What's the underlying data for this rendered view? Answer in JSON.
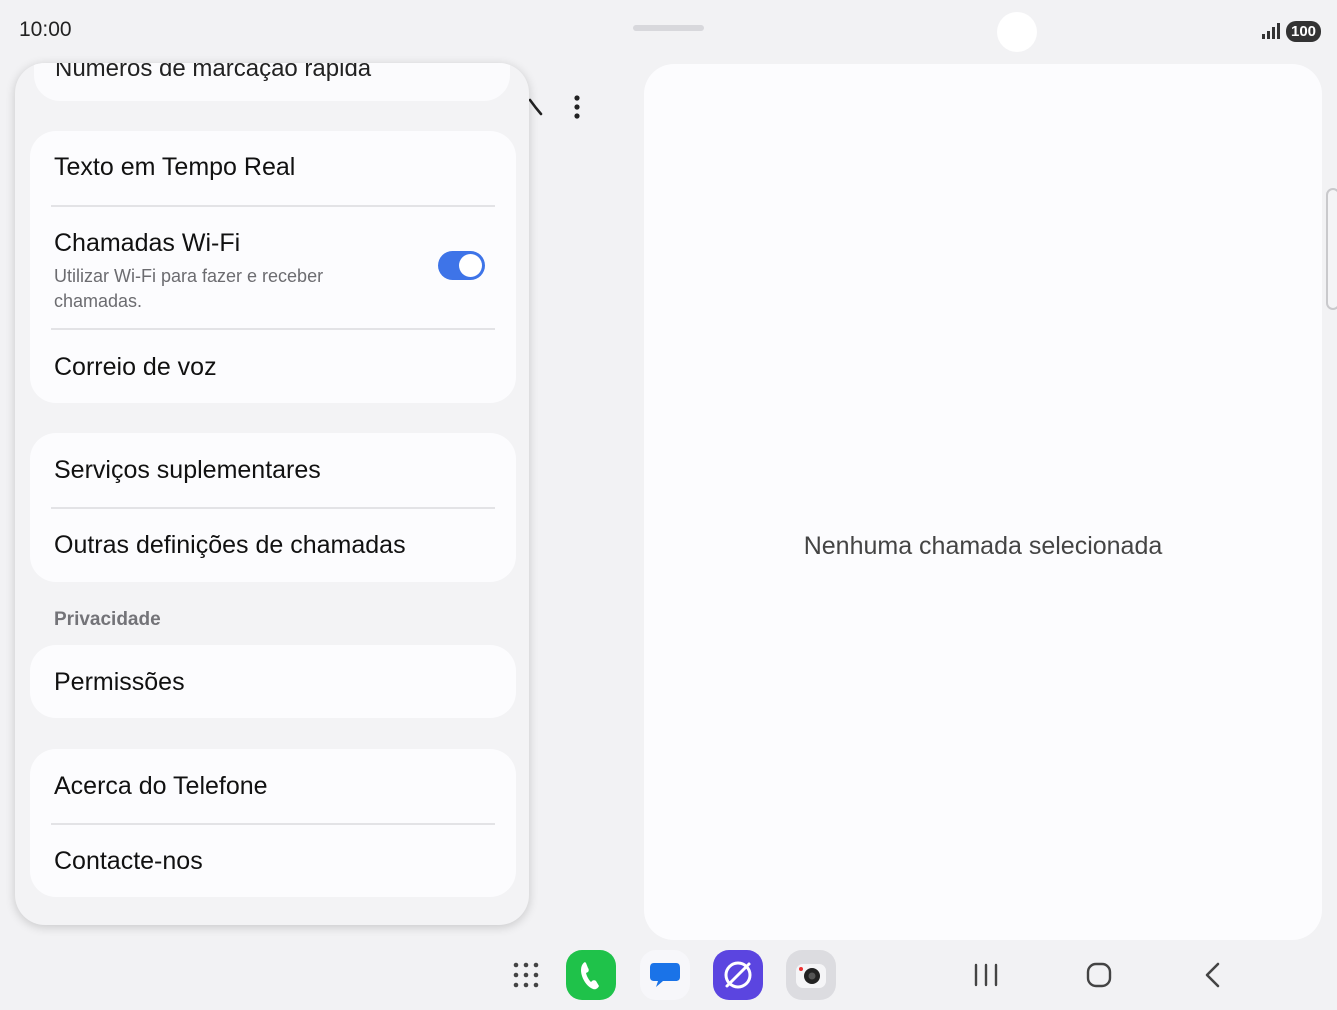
{
  "status_bar": {
    "time": "10:00",
    "battery": "100"
  },
  "settings": {
    "peek_item": "Números de marcação rápida",
    "group1": [
      {
        "title": "Texto em Tempo Real"
      },
      {
        "title": "Chamadas Wi-Fi",
        "subtitle": "Utilizar Wi-Fi para fazer e receber chamadas.",
        "toggle_on": true
      },
      {
        "title": "Correio de voz"
      }
    ],
    "group2": [
      {
        "title": "Serviços suplementares"
      },
      {
        "title": "Outras definições de chamadas"
      }
    ],
    "privacy_section_label": "Privacidade",
    "group3": [
      {
        "title": "Permissões"
      }
    ],
    "group4": [
      {
        "title": "Acerca do Telefone"
      },
      {
        "title": "Contacte-nos"
      }
    ]
  },
  "detail": {
    "empty_message": "Nenhuma chamada selecionada"
  },
  "taskbar": {
    "apps": [
      "phone-app-icon",
      "messages-app-icon",
      "internet-app-icon",
      "camera-app-icon"
    ],
    "toggle_color": "#3e74e8"
  }
}
